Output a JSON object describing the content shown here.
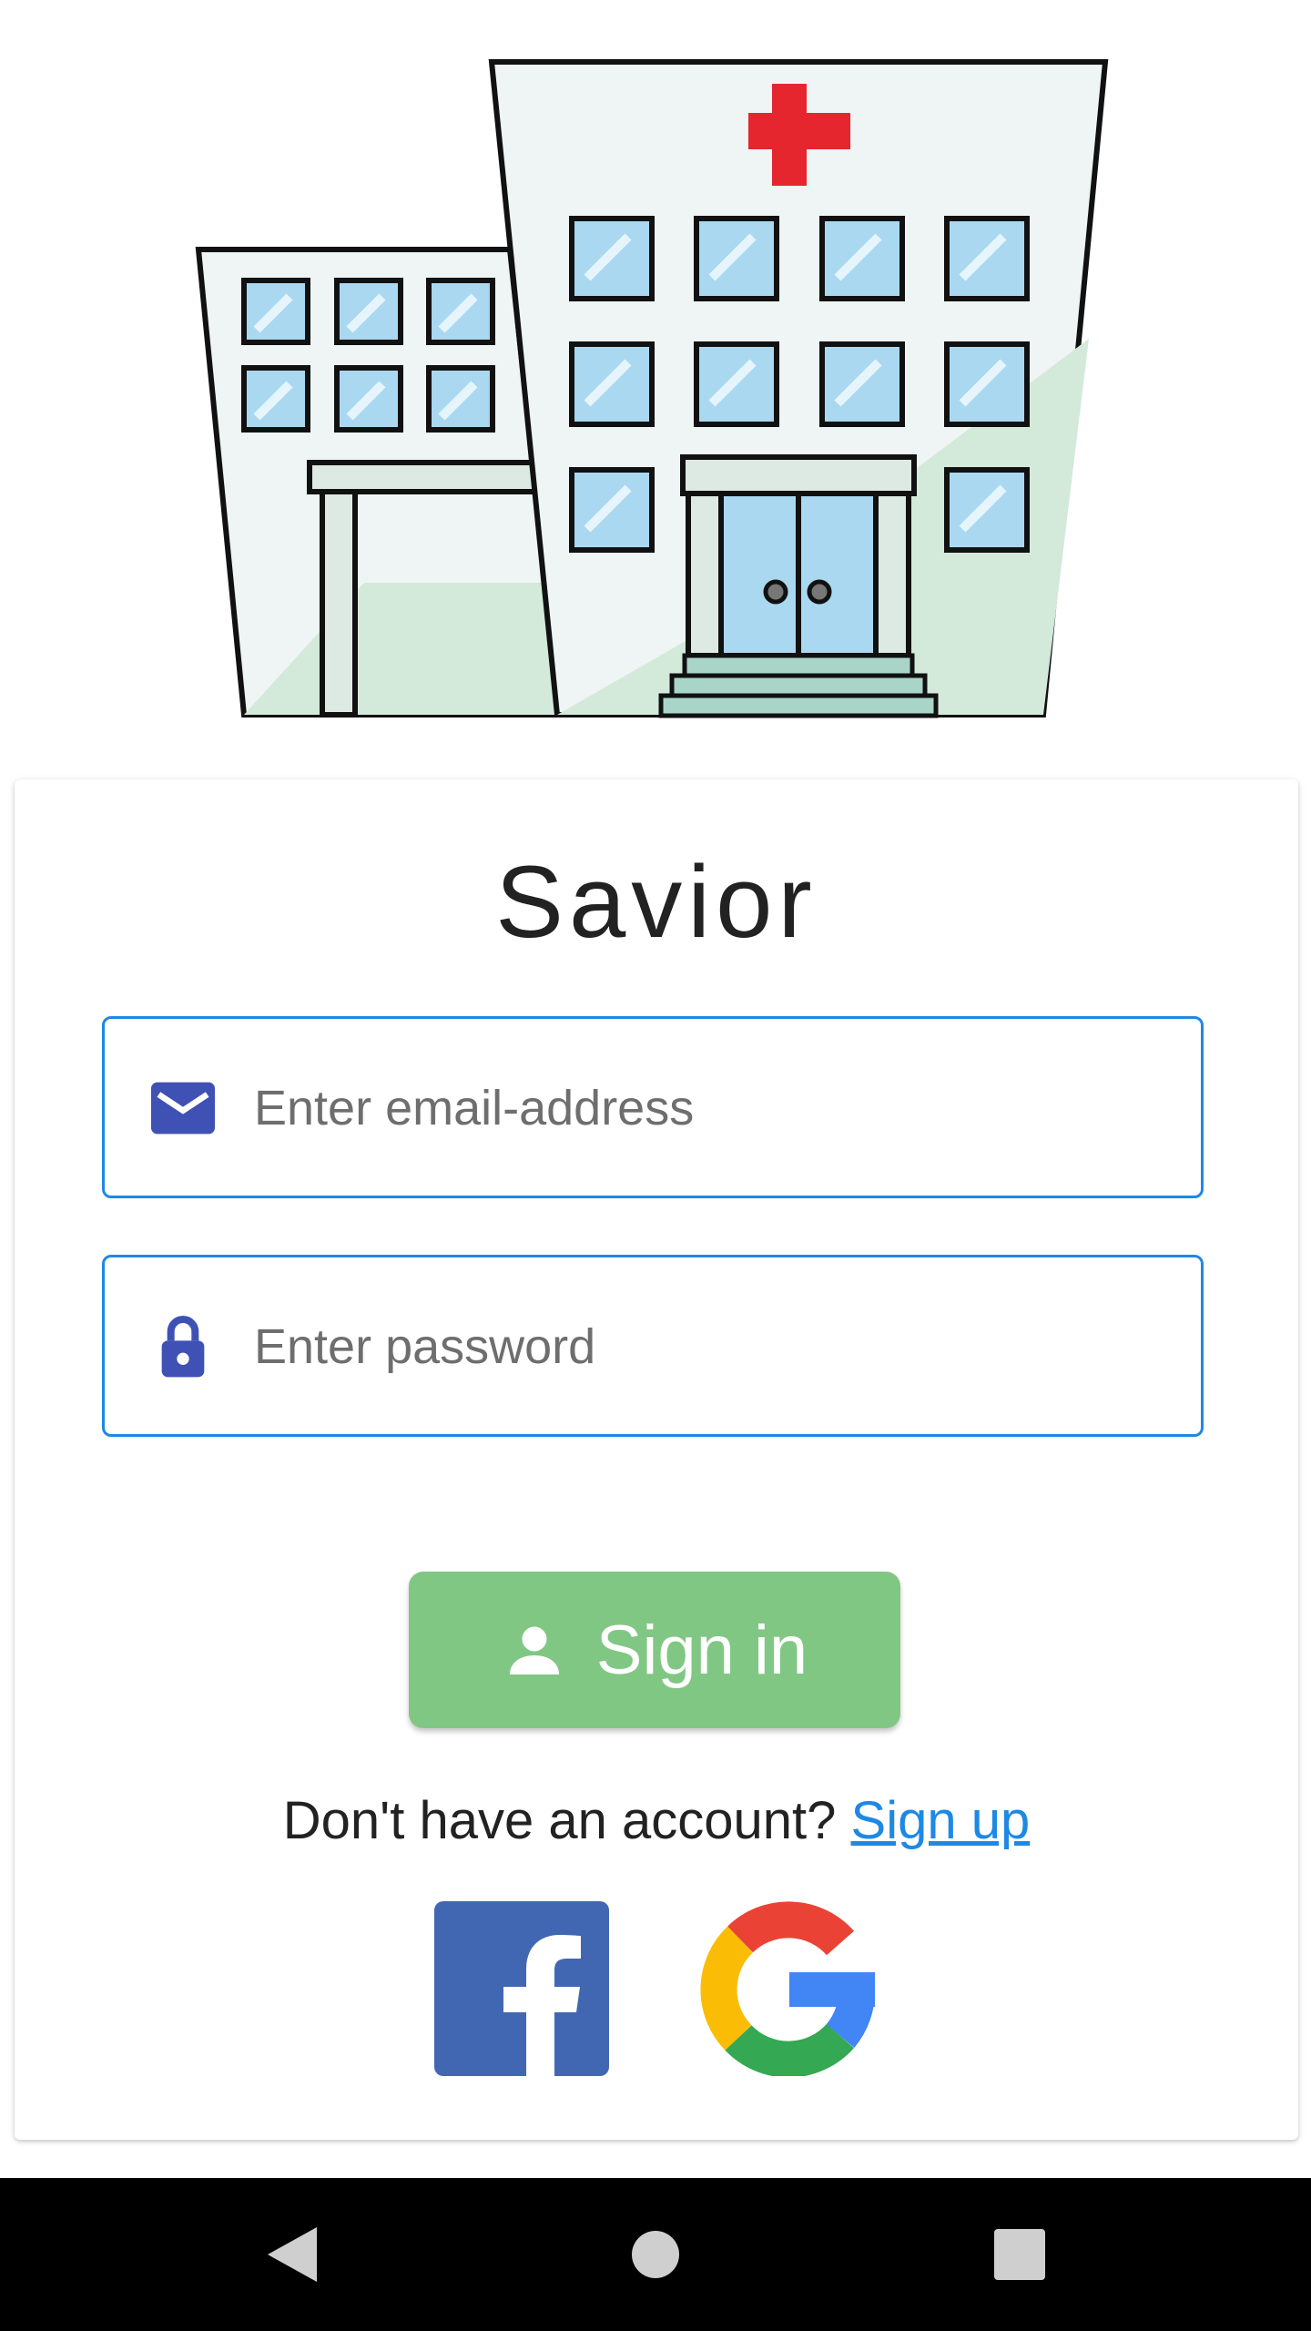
{
  "app": {
    "title": "Savior"
  },
  "login": {
    "email": {
      "placeholder": "Enter email-address",
      "icon": "mail-icon",
      "value": ""
    },
    "password": {
      "placeholder": "Enter password",
      "icon": "lock-icon",
      "value": ""
    },
    "signin_label": "Sign in",
    "signin_icon": "person-icon",
    "signup_prompt": "Don't have an account?",
    "signup_link": "Sign up"
  },
  "social": [
    {
      "name": "facebook",
      "icon": "facebook-icon"
    },
    {
      "name": "google",
      "icon": "google-icon"
    }
  ],
  "colors": {
    "accent_blue": "#1e88e5",
    "icon_indigo": "#3f51b5",
    "signin_green": "#81c784",
    "facebook_blue": "#4267b2",
    "cross_red": "#e5262e"
  },
  "system_nav": [
    "back-icon",
    "home-icon",
    "recents-icon"
  ]
}
